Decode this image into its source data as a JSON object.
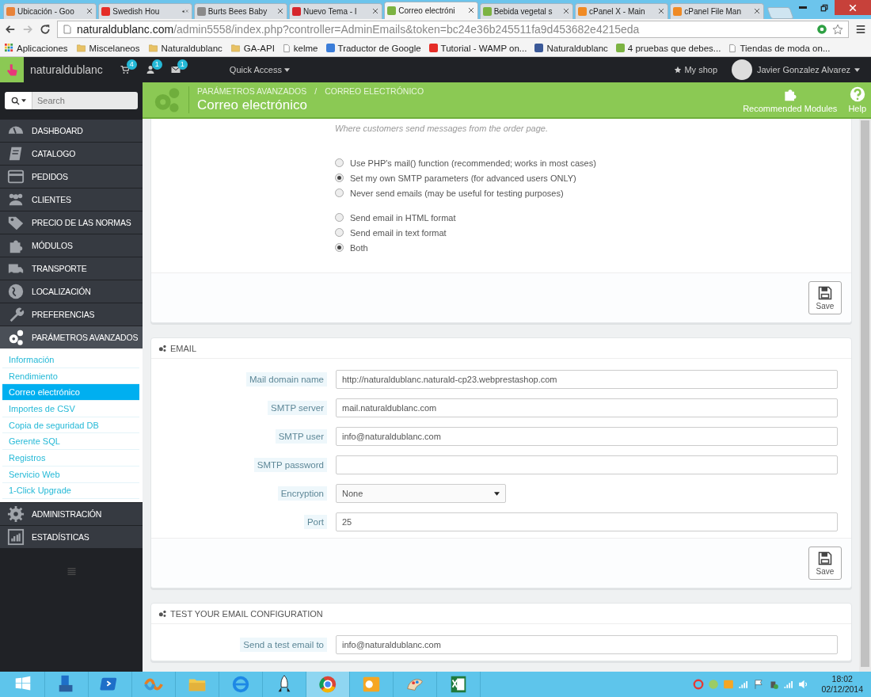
{
  "browser": {
    "tabs": [
      {
        "title": "Ubicación - Goo",
        "selected": false,
        "audio": false,
        "color": "#e8833a"
      },
      {
        "title": "Swedish Hou",
        "selected": false,
        "audio": true,
        "color": "#e52d27"
      },
      {
        "title": "Burts Bees Baby",
        "selected": false,
        "audio": false,
        "color": "#8a8a8a"
      },
      {
        "title": "Nuevo Tema - I",
        "selected": false,
        "audio": false,
        "color": "#d6262c"
      },
      {
        "title": "Correo electróni",
        "selected": true,
        "audio": false,
        "color": "#7cb342"
      },
      {
        "title": "Bebida vegetal s",
        "selected": false,
        "audio": false,
        "color": "#7cb342"
      },
      {
        "title": "cPanel X - Main",
        "selected": false,
        "audio": false,
        "color": "#f08a24"
      },
      {
        "title": "cPanel File Man",
        "selected": false,
        "audio": false,
        "color": "#f08a24"
      }
    ],
    "address": {
      "domain": "naturaldublanc.com",
      "path": "/admin5558/index.php?controller=AdminEmails&token=bc24e36b245511fa9d453682e4215eda"
    },
    "bookmarks": [
      {
        "label": "Aplicaciones",
        "kind": "apps"
      },
      {
        "label": "Miscelaneos",
        "kind": "folder"
      },
      {
        "label": "Naturaldublanc",
        "kind": "folder"
      },
      {
        "label": "GA-API",
        "kind": "folder"
      },
      {
        "label": "kelme",
        "kind": "page"
      },
      {
        "label": "Traductor de Google",
        "kind": "site",
        "color": "#3b7dd8"
      },
      {
        "label": "Tutorial - WAMP on...",
        "kind": "site",
        "color": "#e52d27"
      },
      {
        "label": "Naturaldublanc",
        "kind": "site",
        "color": "#3b5998"
      },
      {
        "label": "4 pruebas que debes...",
        "kind": "site",
        "color": "#7cb342"
      },
      {
        "label": "Tiendas de moda on...",
        "kind": "page"
      }
    ]
  },
  "admin_bar": {
    "brand": "naturaldublanc",
    "badges": [
      "4",
      "1",
      "1"
    ],
    "quick_access": "Quick Access",
    "my_shop": "My shop",
    "user": "Javier Gonzalez Alvarez"
  },
  "search": {
    "placeholder": "Search"
  },
  "header": {
    "breadcrumbs": [
      "PARÁMETROS AVANZADOS",
      "CORREO ELECTRÓNICO"
    ],
    "separator": "/",
    "title": "Correo electrónico",
    "actions": [
      "Recommended Modules",
      "Help"
    ]
  },
  "sidebar": {
    "items": [
      {
        "label": "DASHBOARD",
        "selected": false
      },
      {
        "label": "CATALOGO",
        "selected": false
      },
      {
        "label": "PEDIDOS",
        "selected": false
      },
      {
        "label": "CLIENTES",
        "selected": false
      },
      {
        "label": "PRECIO DE LAS NORMAS",
        "selected": false
      },
      {
        "label": "MÓDULOS",
        "selected": false
      },
      {
        "label": "TRANSPORTE",
        "selected": false
      },
      {
        "label": "LOCALIZACIÓN",
        "selected": false
      },
      {
        "label": "PREFERENCIAS",
        "selected": false
      },
      {
        "label": "PARÁMETROS AVANZADOS",
        "selected": true,
        "children": [
          {
            "label": "Información",
            "selected": false
          },
          {
            "label": "Rendimiento",
            "selected": false
          },
          {
            "label": "Correo electrónico",
            "selected": true
          },
          {
            "label": "Importes de CSV",
            "selected": false
          },
          {
            "label": "Copia de seguridad DB",
            "selected": false
          },
          {
            "label": "Gerente SQL",
            "selected": false
          },
          {
            "label": "Registros",
            "selected": false
          },
          {
            "label": "Servicio Web",
            "selected": false
          },
          {
            "label": "1-Click Upgrade",
            "selected": false
          }
        ]
      },
      {
        "label": "ADMINISTRACIÓN",
        "selected": false
      },
      {
        "label": "ESTADÍSTICAS",
        "selected": false
      }
    ]
  },
  "mail_panel": {
    "hint": "Where customers send messages from the order page.",
    "groups": [
      [
        {
          "label": "Use PHP's mail() function (recommended; works in most cases)",
          "selected": false
        },
        {
          "label": "Set my own SMTP parameters (for advanced users ONLY)",
          "selected": true
        },
        {
          "label": "Never send emails (may be useful for testing purposes)",
          "selected": false
        }
      ],
      [
        {
          "label": "Send email in HTML format",
          "selected": false
        },
        {
          "label": "Send email in text format",
          "selected": false
        },
        {
          "label": "Both",
          "selected": true
        }
      ]
    ],
    "save": "Save"
  },
  "email_panel": {
    "title": "EMAIL",
    "fields": [
      {
        "label": "Mail domain name",
        "value": "http://naturaldublanc.naturald-cp23.webprestashop.com",
        "kind": "text"
      },
      {
        "label": "SMTP server",
        "value": "mail.naturaldublanc.com",
        "kind": "text"
      },
      {
        "label": "SMTP user",
        "value": "info@naturaldublanc.com",
        "kind": "text"
      },
      {
        "label": "SMTP password",
        "kind": "password"
      },
      {
        "label": "Encryption",
        "value": "None",
        "kind": "select"
      },
      {
        "label": "Port",
        "value": "25",
        "kind": "text"
      }
    ],
    "save": "Save"
  },
  "test_panel": {
    "title": "TEST YOUR EMAIL CONFIGURATION",
    "fields": [
      {
        "label": "Send a test email to",
        "value": "info@naturaldublanc.com",
        "kind": "text"
      }
    ]
  },
  "taskbar": {
    "apps": [
      {
        "selected": false
      },
      {
        "selected": false
      },
      {
        "selected": false
      },
      {
        "selected": false
      },
      {
        "selected": false
      },
      {
        "selected": false
      },
      {
        "selected": false
      },
      {
        "selected": true
      },
      {
        "selected": false
      },
      {
        "selected": false
      },
      {
        "selected": false
      }
    ],
    "time": "18:02",
    "date": "02/12/2014"
  }
}
